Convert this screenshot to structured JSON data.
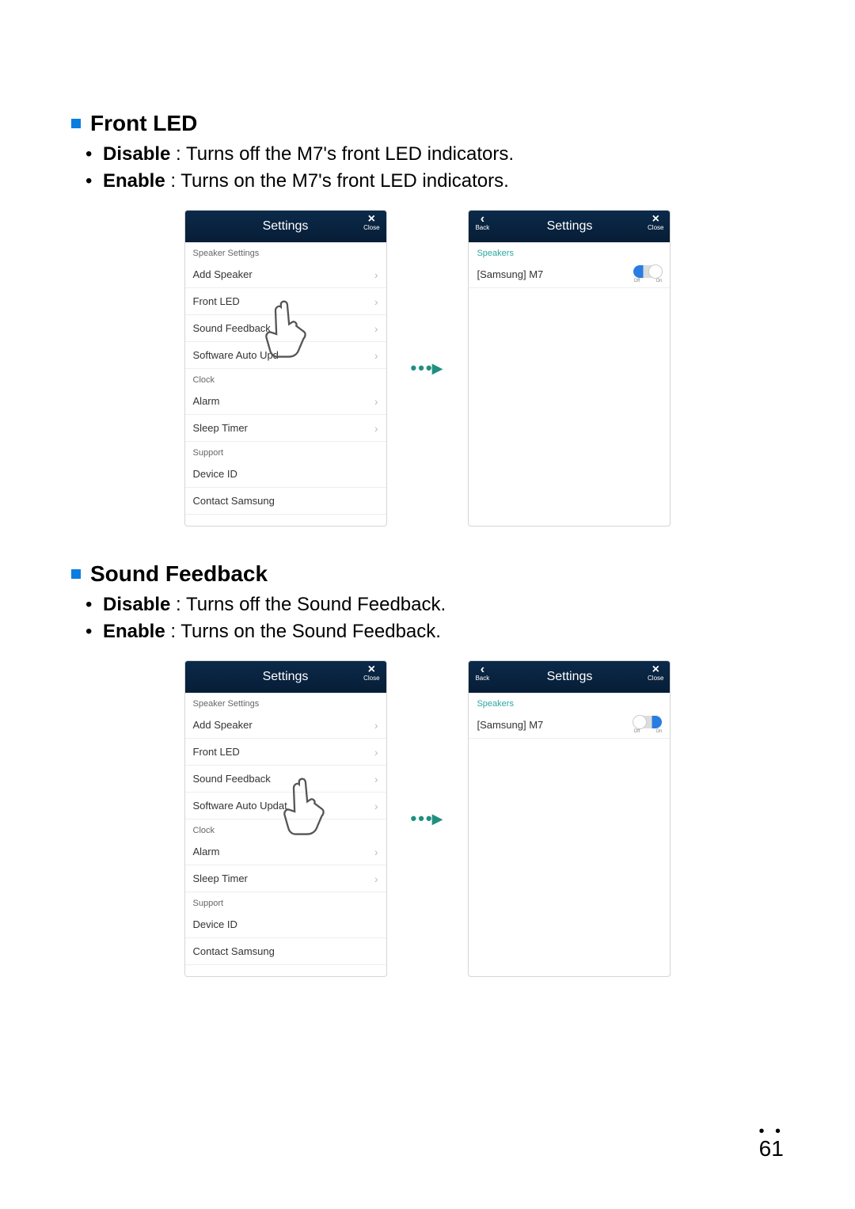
{
  "page_number": "61",
  "sections": {
    "frontLed": {
      "heading": "Front LED",
      "disable_label": "Disable",
      "disable_text": " : Turns off the M7's front LED indicators.",
      "enable_label": "Enable",
      "enable_text": " : Turns on the M7's front LED indicators."
    },
    "soundFeedback": {
      "heading": "Sound Feedback",
      "disable_label": "Disable",
      "disable_text": " : Turns off the Sound Feedback.",
      "enable_label": "Enable",
      "enable_text": " : Turns on the Sound Feedback."
    }
  },
  "labels": {
    "close": "Close",
    "back": "Back",
    "off": "Off",
    "on": "On"
  },
  "screens": {
    "settingsList": {
      "title": "Settings",
      "groups": {
        "speaker": "Speaker Settings",
        "clock": "Clock",
        "support": "Support"
      },
      "items": {
        "add_speaker": "Add Speaker",
        "front_led": "Front LED",
        "sound_feedback": "Sound Feedback",
        "software_update": "Software Auto Update",
        "software_update_trunc1": "Software Auto Upd",
        "software_update_trunc2": "Software Auto Updat",
        "alarm": "Alarm",
        "sleep_timer": "Sleep Timer",
        "device_id": "Device ID",
        "contact_samsung": "Contact Samsung"
      }
    },
    "speakerDetail": {
      "title": "Settings",
      "group": "Speakers",
      "device": "[Samsung] M7"
    }
  }
}
